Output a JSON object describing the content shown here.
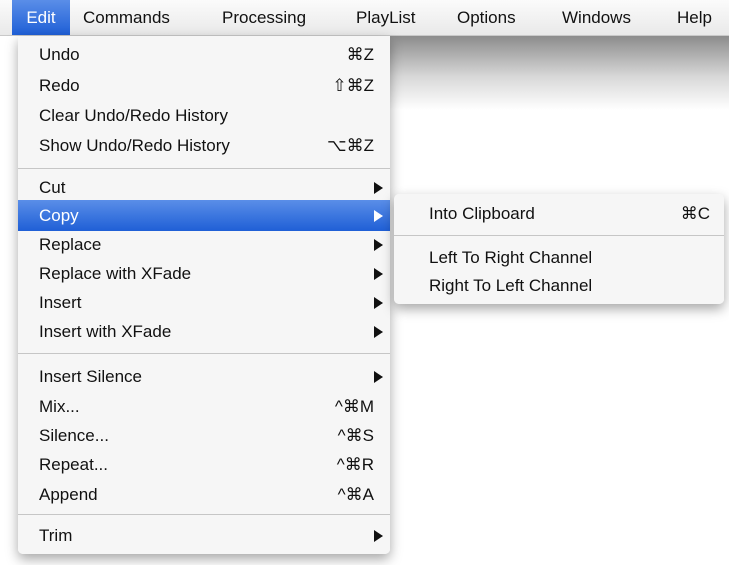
{
  "menubar": {
    "items": [
      {
        "label": "Edit"
      },
      {
        "label": "Commands"
      },
      {
        "label": "Processing"
      },
      {
        "label": "PlayList"
      },
      {
        "label": "Options"
      },
      {
        "label": "Windows"
      },
      {
        "label": "Help"
      }
    ]
  },
  "edit_menu": {
    "items": [
      {
        "label": "Undo",
        "shortcut": "⌘Z"
      },
      {
        "label": "Redo",
        "shortcut": "⇧⌘Z"
      },
      {
        "label": "Clear Undo/Redo History",
        "shortcut": ""
      },
      {
        "label": "Show Undo/Redo History",
        "shortcut": "⌥⌘Z"
      },
      {
        "label": "Cut",
        "submenu": true
      },
      {
        "label": "Copy",
        "submenu": true,
        "highlighted": true
      },
      {
        "label": "Replace",
        "submenu": true
      },
      {
        "label": "Replace with XFade",
        "submenu": true
      },
      {
        "label": "Insert",
        "submenu": true
      },
      {
        "label": "Insert with XFade",
        "submenu": true
      },
      {
        "label": "Insert Silence",
        "submenu": true
      },
      {
        "label": "Mix...",
        "shortcut": "^⌘M"
      },
      {
        "label": "Silence...",
        "shortcut": "^⌘S"
      },
      {
        "label": "Repeat...",
        "shortcut": "^⌘R"
      },
      {
        "label": "Append",
        "shortcut": "^⌘A"
      },
      {
        "label": "Trim",
        "submenu": true
      }
    ]
  },
  "copy_submenu": {
    "items": [
      {
        "label": "Into Clipboard",
        "shortcut": "⌘C"
      },
      {
        "label": "Left To Right Channel"
      },
      {
        "label": "Right To Left Channel"
      }
    ]
  },
  "colors": {
    "highlight": "#2a67db",
    "menu_background": "#f6f6f6",
    "separator": "#c6c6c6"
  },
  "icons": [
    "submenu-arrow-icon"
  ]
}
